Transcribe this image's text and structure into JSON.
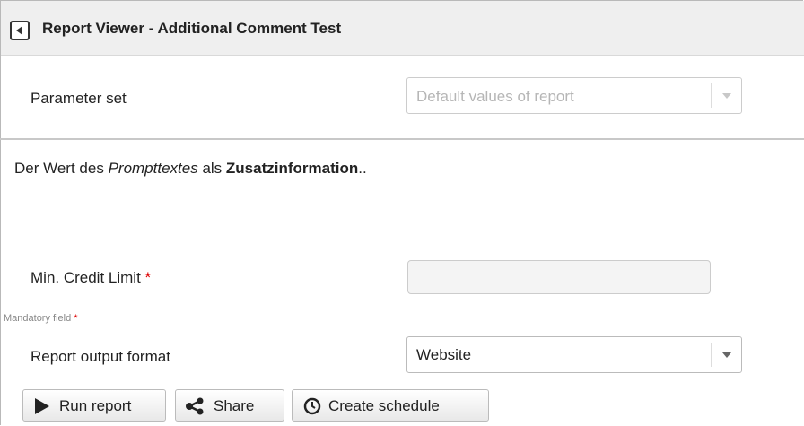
{
  "window": {
    "title": "Report Viewer - Additional Comment Test"
  },
  "parameter_set": {
    "label": "Parameter set",
    "value": "Default values of report"
  },
  "info_text": {
    "part1": "Der Wert des ",
    "italic": "Prompttextes",
    "part2": " als ",
    "bold": "Zusatzinformation",
    "part3": ".."
  },
  "credit_limit": {
    "label": "Min. Credit Limit",
    "required_marker": "*",
    "value": ""
  },
  "mandatory_note": {
    "text": "Mandatory field",
    "marker": "*"
  },
  "output_format": {
    "label": "Report output format",
    "value": "Website"
  },
  "buttons": {
    "run": "Run report",
    "share": "Share",
    "schedule": "Create schedule"
  },
  "icons": {
    "back": "back-arrow-icon",
    "run": "play-icon",
    "share": "share-icon",
    "schedule": "clock-icon"
  },
  "colors": {
    "required": "#dd0000",
    "titlebar": "#efefef"
  }
}
